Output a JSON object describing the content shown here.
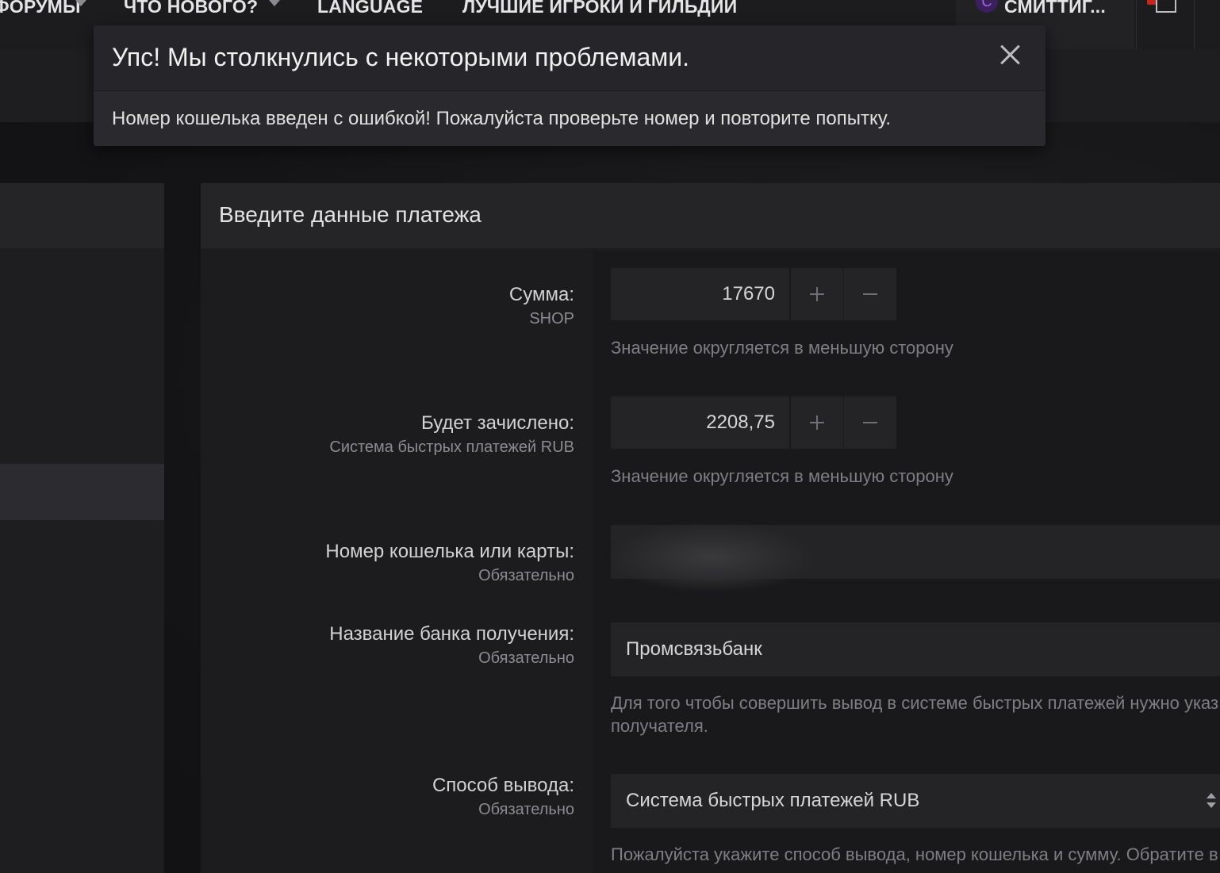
{
  "nav": {
    "items": [
      {
        "label": "Форумы"
      },
      {
        "label": "Что нового?"
      },
      {
        "label": "Language"
      },
      {
        "label": "Лучшие игроки и гильдии"
      }
    ],
    "user_initial": "С",
    "user_name": "Смиттиг..."
  },
  "modal": {
    "title": "Упс! Мы столкнулись с некоторыми проблемами.",
    "message": "Номер кошелька введен с ошибкой! Пожалуйста проверьте номер и повторите попытку."
  },
  "panel": {
    "title": "Введите данные платежа",
    "amount": {
      "label": "Сумма:",
      "sub": "SHOP",
      "value": "17670",
      "hint": "Значение округляется в меньшую сторону"
    },
    "credited": {
      "label": "Будет зачислено:",
      "sub": "Система быстрых платежей RUB",
      "value": "2208,75",
      "hint": "Значение округляется в меньшую сторону"
    },
    "wallet": {
      "label": "Номер кошелька или карты:",
      "sub": "Обязательно"
    },
    "bank": {
      "label": "Название банка получения:",
      "sub": "Обязательно",
      "value": "Промсвязьбанк",
      "hint_line1": "Для того чтобы совершить вывод в системе быстрых платежей нужно указ",
      "hint_line2": "получателя."
    },
    "method": {
      "label": "Способ вывода:",
      "sub": "Обязательно",
      "value": "Система быстрых платежей RUB",
      "hint": "Пожалуйста укажите способ вывода, номер кошелька и сумму. Обратите в"
    }
  }
}
